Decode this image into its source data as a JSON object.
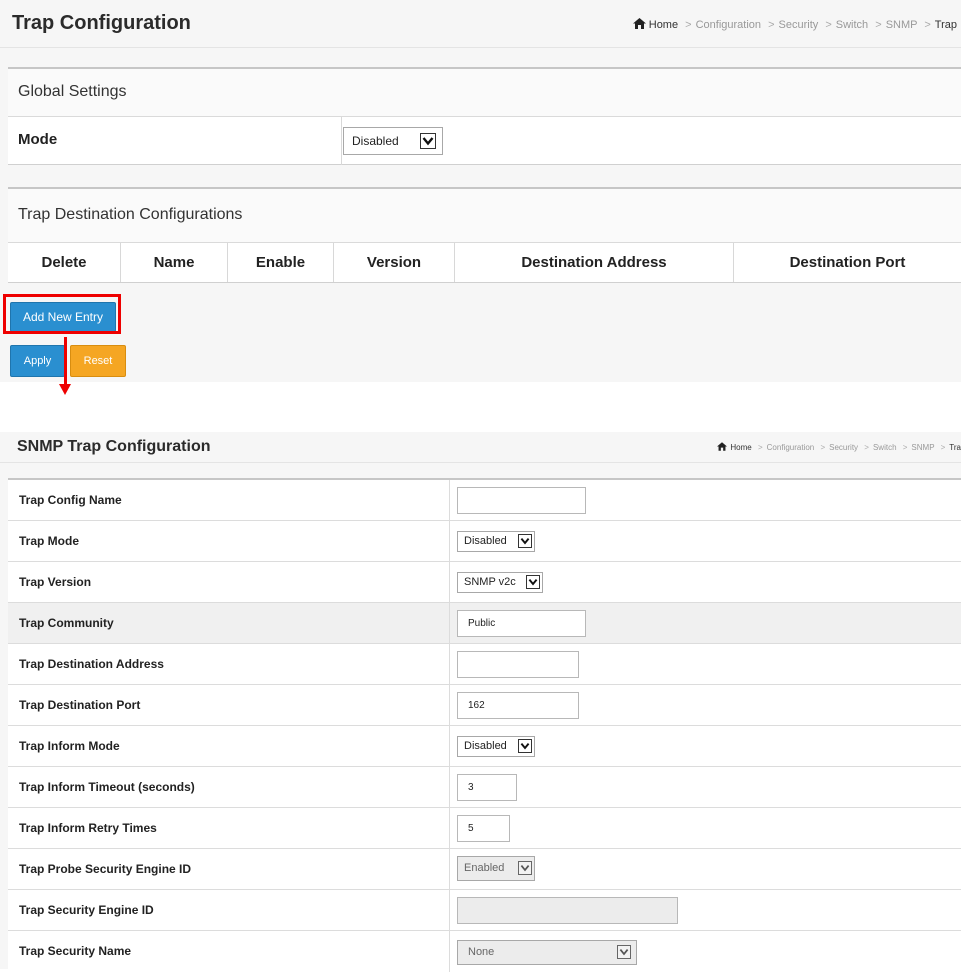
{
  "top": {
    "title": "Trap Configuration",
    "breadcrumb": {
      "home": "Home",
      "items": [
        "Configuration",
        "Security",
        "Switch",
        "SNMP"
      ],
      "last": "Trap"
    },
    "global_settings": {
      "heading": "Global Settings",
      "mode_label": "Mode",
      "mode_value": "Disabled"
    },
    "destinations": {
      "heading": "Trap Destination Configurations",
      "columns": [
        "Delete",
        "Name",
        "Enable",
        "Version",
        "Destination Address",
        "Destination Port"
      ]
    },
    "buttons": {
      "add_new_entry": "Add New Entry",
      "apply": "Apply",
      "reset": "Reset"
    }
  },
  "bottom": {
    "title": "SNMP Trap Configuration",
    "breadcrumb": {
      "home": "Home",
      "items": [
        "Configuration",
        "Security",
        "Switch",
        "SNMP"
      ],
      "last": "Tra"
    },
    "rows": {
      "config_name": {
        "label": "Trap Config Name",
        "value": ""
      },
      "mode": {
        "label": "Trap Mode",
        "value": "Disabled"
      },
      "version": {
        "label": "Trap Version",
        "value": "SNMP v2c"
      },
      "community": {
        "label": "Trap Community",
        "value": "Public"
      },
      "dest_address": {
        "label": "Trap Destination Address",
        "value": ""
      },
      "dest_port": {
        "label": "Trap Destination Port",
        "value": "162"
      },
      "inform_mode": {
        "label": "Trap Inform Mode",
        "value": "Disabled"
      },
      "inform_timeout": {
        "label": "Trap Inform Timeout (seconds)",
        "value": "3"
      },
      "inform_retry": {
        "label": "Trap Inform Retry Times",
        "value": "5"
      },
      "probe_engine_id": {
        "label": "Trap Probe Security Engine ID",
        "value": "Enabled"
      },
      "security_engine_id": {
        "label": "Trap Security Engine ID",
        "value": ""
      },
      "security_name": {
        "label": "Trap Security Name",
        "value": "None"
      }
    }
  },
  "colors": {
    "primary_button": "#2a8fd0",
    "reset_button": "#f5a623",
    "highlight": "#ee0000"
  }
}
